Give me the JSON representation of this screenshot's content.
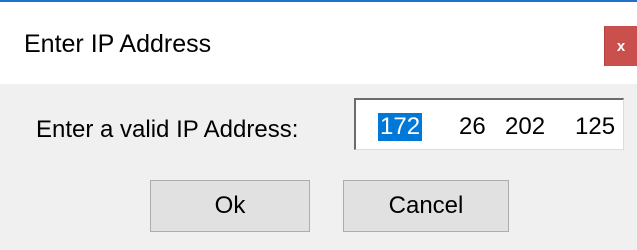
{
  "dialog": {
    "title": "Enter IP Address",
    "close_glyph": "x",
    "prompt_label": "Enter a valid IP Address:",
    "ip_octets": [
      "172",
      "26",
      "202",
      "125"
    ],
    "selected_octet_index": 0,
    "ok_label": "Ok",
    "cancel_label": "Cancel"
  },
  "colors": {
    "title_border": "#1f73c7",
    "close_button": "#c9504c",
    "selection": "#0078d7",
    "dialog_background": "#f0f0f0"
  }
}
